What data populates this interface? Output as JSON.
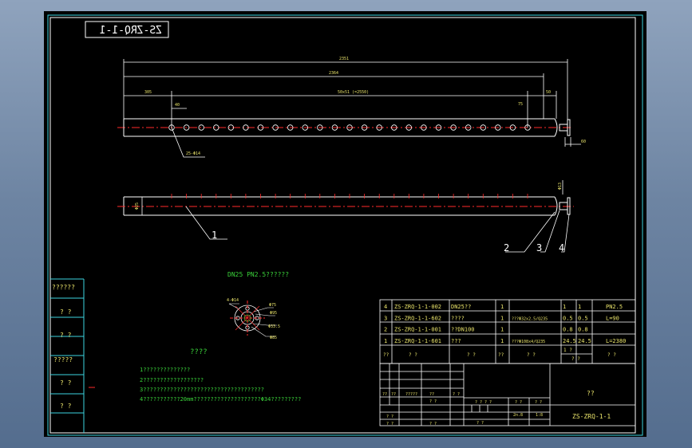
{
  "drawing": {
    "drawing_code_mirrored": "ZS-ZRQ-1-1",
    "dims_top": [
      "2351",
      "2364",
      "305",
      "40",
      "50x51 (=2550)",
      "75",
      "50",
      "60"
    ],
    "hole_callout": "25-Φ14",
    "part_numbers": [
      "1",
      "2",
      "3",
      "4"
    ],
    "side_dims": [
      "Φ25",
      "Φ13"
    ],
    "section_title": "DN25 PN2.5??????",
    "section_dims": [
      "4-Φ14",
      "Φ75",
      "Φ95",
      "Φ33.5",
      "Φ85"
    ],
    "notes_title": "????",
    "notes": [
      "1??????????????",
      "2??????????????????",
      "3????????????????????????????????????",
      "4???????????20mm????????????????????Φ34?????????"
    ],
    "left_strip_labels": [
      "??????",
      "? ?",
      "? ?",
      "?????",
      "? ?",
      "? ?"
    ]
  },
  "bom": {
    "rows": [
      {
        "no": "4",
        "code": "ZS-ZRQ-1-1-002",
        "name": "DN25??",
        "qty": "1",
        "material": "",
        "unit": "1",
        "total": "1",
        "remark": "PN2.5"
      },
      {
        "no": "3",
        "code": "ZS-ZRQ-1-1-602",
        "name": "????",
        "qty": "1",
        "material": "???Φ32x2.5/Q235",
        "unit": "0.5",
        "total": "0.5",
        "remark": "L=90"
      },
      {
        "no": "2",
        "code": "ZS-ZRQ-1-1-001",
        "name": "??DN100",
        "qty": "1",
        "material": "",
        "unit": "0.8",
        "total": "0.8",
        "remark": ""
      },
      {
        "no": "1",
        "code": "ZS-ZRQ-1-1-601",
        "name": "???",
        "qty": "1",
        "material": "???Φ108x4/Q235",
        "unit": "24.5",
        "total": "24.5",
        "remark": "L=2380"
      }
    ],
    "header": [
      "??",
      "?  ?",
      "?  ?",
      "??",
      "?  ?",
      "1 ?",
      "? ?",
      "? ?"
    ]
  },
  "title_block": {
    "sign_labels": [
      "??",
      "??",
      "?????",
      "??",
      "? ?",
      "? ?",
      "? ?",
      "? ?",
      "? ?"
    ],
    "scale_label": "? ? ? ?",
    "row2": [
      "? ?",
      "? ?"
    ],
    "weight": "2n.8",
    "scale": "1:8",
    "sheet": "? ?",
    "drawing_name": "??",
    "drawing_code": "ZS-ZRQ-1-1"
  },
  "colors": {
    "line": "#ffffff",
    "dim": "#e9e36a",
    "section": "#3ad33a",
    "border": "#3bd4e0",
    "center": "#ff2a2a"
  }
}
